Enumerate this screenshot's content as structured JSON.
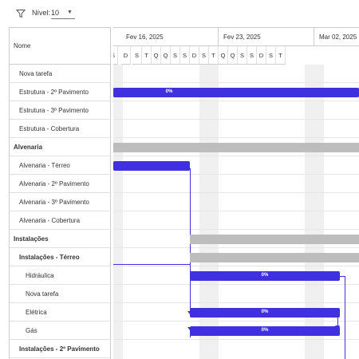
{
  "toolbar": {
    "filter_icon": "filter-icon",
    "level_label": "Nível:",
    "level_value": "10",
    "dropdown_icon": "chevron-down-icon"
  },
  "task_list": {
    "header": "Nome",
    "rows": [
      {
        "label": "Nova tarefa"
      },
      {
        "label": "Estrutura - 2º Pavimento"
      },
      {
        "label": "Estrutura - 3º Pavimento"
      },
      {
        "label": "Estrutura - Cobertura"
      },
      {
        "label": "Alvenaria"
      },
      {
        "label": "Alvenaria - Térreo"
      },
      {
        "label": "Alvenaria - 2º Pavimento"
      },
      {
        "label": "Alvenaria - 3º Pavimento"
      },
      {
        "label": "Alvenaria - Cobertura"
      },
      {
        "label": "Instalações"
      },
      {
        "label": "Instalações - Térreo"
      },
      {
        "label": "Hidráulica"
      },
      {
        "label": "Nova tarefa"
      },
      {
        "label": "Elétrica"
      },
      {
        "label": "Gás"
      },
      {
        "label": "Instalações - 2º Pavimento"
      }
    ]
  },
  "timeline": {
    "weeks": [
      "Fev 16, 2025",
      "Fev 23, 2025",
      "Mar 02, 2025"
    ],
    "days": [
      "S",
      "D",
      "S",
      "T",
      "Q",
      "Q",
      "S",
      "S",
      "D",
      "S",
      "T",
      "Q",
      "Q",
      "S",
      "S",
      "D",
      "S",
      "T"
    ]
  },
  "bars": {
    "estrutura_2": {
      "label": "0%",
      "progress": 0
    },
    "alvenaria": {
      "label": ""
    },
    "alvenaria_terreo": {
      "label": ""
    },
    "instalacoes": {
      "label": ""
    },
    "instalacoes_terreo": {
      "label": ""
    },
    "hidraulica": {
      "label": "0%",
      "progress": 0
    },
    "eletrica": {
      "label": "0%",
      "progress": 0
    },
    "gas": {
      "label": "0%",
      "progress": 0
    }
  },
  "colors": {
    "task_bar": "#3f31e0",
    "summary_bar": "#bdbdbd",
    "weekend_shade": "#f0f0f0"
  }
}
